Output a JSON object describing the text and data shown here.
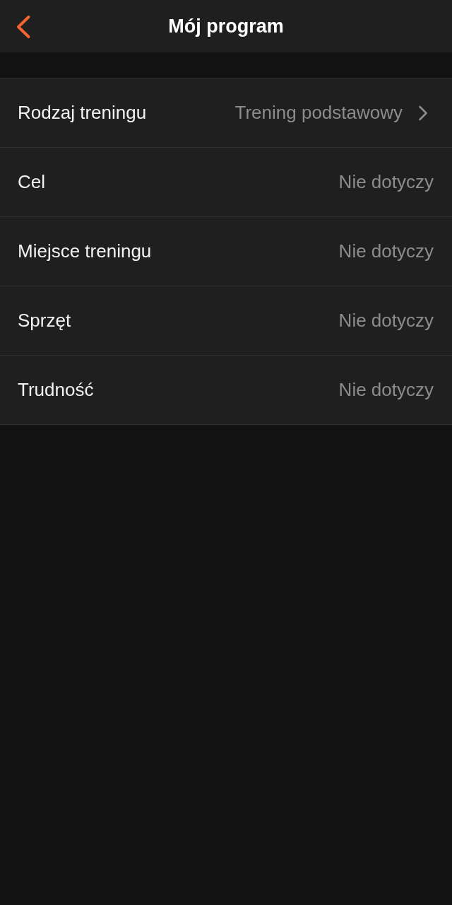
{
  "header": {
    "title": "Mój program"
  },
  "settings": [
    {
      "label": "Rodzaj treningu",
      "value": "Trening podstawowy",
      "chevron": true
    },
    {
      "label": "Cel",
      "value": "Nie dotyczy",
      "chevron": false
    },
    {
      "label": "Miejsce treningu",
      "value": "Nie dotyczy",
      "chevron": false
    },
    {
      "label": "Sprzęt",
      "value": "Nie dotyczy",
      "chevron": false
    },
    {
      "label": "Trudność",
      "value": "Nie dotyczy",
      "chevron": false
    }
  ]
}
